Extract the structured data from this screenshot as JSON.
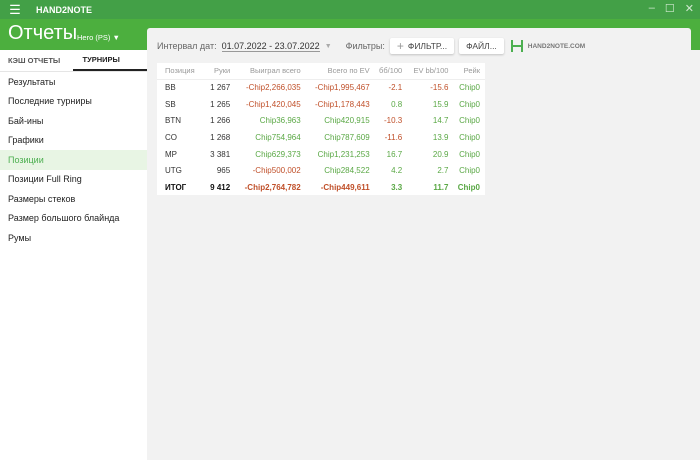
{
  "app": {
    "name": "HAND2NOTE",
    "title": "Отчеты",
    "player": "Hero (PS)"
  },
  "tabs": [
    {
      "label": "КЭШ ОТЧЕТЫ"
    },
    {
      "label": "ТУРНИРЫ",
      "active": true
    }
  ],
  "sidebar": {
    "items": [
      {
        "label": "Результаты"
      },
      {
        "label": "Последние турниры"
      },
      {
        "label": "Бай-ины"
      },
      {
        "label": "Графики"
      },
      {
        "label": "Позиции",
        "active": true
      },
      {
        "label": "Позиции Full Ring"
      },
      {
        "label": "Размеры стеков"
      },
      {
        "label": "Размер большого блайнда"
      },
      {
        "label": "Румы"
      }
    ]
  },
  "filters": {
    "date_label": "Интервал дат:",
    "date_value": "01.07.2022 - 23.07.2022",
    "filters_label": "Фильтры:",
    "filter_button": "ФИЛЬТР...",
    "file_button": "ФАЙЛ...",
    "logo_text": "HAND2NOTE.COM"
  },
  "table": {
    "columns": [
      "Позиция",
      "Руки",
      "Выиграл всего",
      "Всего по EV",
      "бб/100",
      "EV bb/100",
      "Рейк"
    ],
    "rows": [
      [
        "BB",
        "1 267",
        "-Chip2,266,035",
        "-Chip1,995,467",
        "-2.1",
        "-15.6",
        "Chip0"
      ],
      [
        "SB",
        "1 265",
        "-Chip1,420,045",
        "-Chip1,178,443",
        "0.8",
        "15.9",
        "Chip0"
      ],
      [
        "BTN",
        "1 266",
        "Chip36,963",
        "Chip420,915",
        "-10.3",
        "14.7",
        "Chip0"
      ],
      [
        "CO",
        "1 268",
        "Chip754,964",
        "Chip787,609",
        "-11.6",
        "13.9",
        "Chip0"
      ],
      [
        "MP",
        "3 381",
        "Chip629,373",
        "Chip1,231,253",
        "16.7",
        "20.9",
        "Chip0"
      ],
      [
        "UTG",
        "965",
        "-Chip500,002",
        "Chip284,522",
        "4.2",
        "2.7",
        "Chip0"
      ]
    ],
    "total": [
      "ИТОГ",
      "9 412",
      "-Chip2,764,782",
      "-Chip449,611",
      "3.3",
      "11.7",
      "Chip0"
    ]
  },
  "colors": {
    "titlebar": "#43a047",
    "header": "#4caf3e",
    "negative": "#c0502a",
    "positive": "#5aa845"
  }
}
